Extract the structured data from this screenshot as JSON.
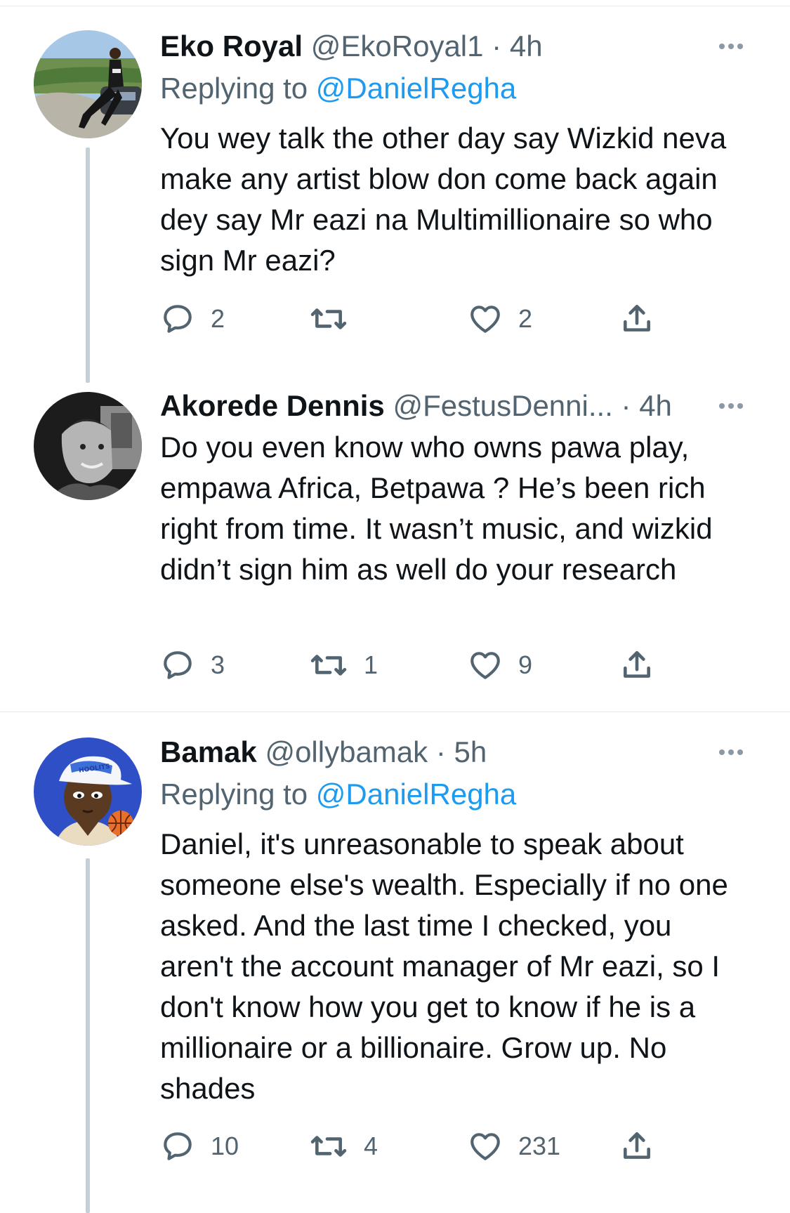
{
  "tweets": [
    {
      "name": "Eko Royal",
      "handle": "@EkoRoyal1",
      "sep": "·",
      "time": "4h",
      "replying_prefix": "Replying to",
      "replying_to": "@DanielRegha",
      "text": "You wey talk the other day say Wizkid neva make any artist blow don come back again dey say Mr eazi na Multimillionaire so who sign Mr eazi?",
      "replies": "2",
      "retweets": "",
      "likes": "2"
    },
    {
      "name": "Akorede Dennis",
      "handle": "@FestusDenni...",
      "sep": "·",
      "time": "4h",
      "text": "Do you even know who owns pawa play, empawa Africa, Betpawa ? He’s been rich right from time. It wasn’t music, and wizkid didn’t sign him as well do your research",
      "replies": "3",
      "retweets": "1",
      "likes": "9"
    },
    {
      "name": "Bamak",
      "handle": "@ollybamak",
      "sep": "·",
      "time": "5h",
      "replying_prefix": "Replying to",
      "replying_to": "@DanielRegha",
      "text": "Daniel, it's unreasonable to speak about someone else's wealth. Especially if no one asked. And the last time I checked, you aren't the account manager of Mr eazi, so I don't know how you get to know if he is a millionaire or a billionaire. Grow up. No shades",
      "replies": "10",
      "retweets": "4",
      "likes": "231",
      "avatar_cap_text": "HOOLITS"
    }
  ],
  "icons": {
    "reply": "reply-icon",
    "retweet": "retweet-icon",
    "like": "heart-icon",
    "share": "share-icon",
    "more": "more-icon"
  },
  "colors": {
    "link": "#1d9bf0",
    "secondary": "#536471",
    "thread_line": "#c4cfd6"
  }
}
